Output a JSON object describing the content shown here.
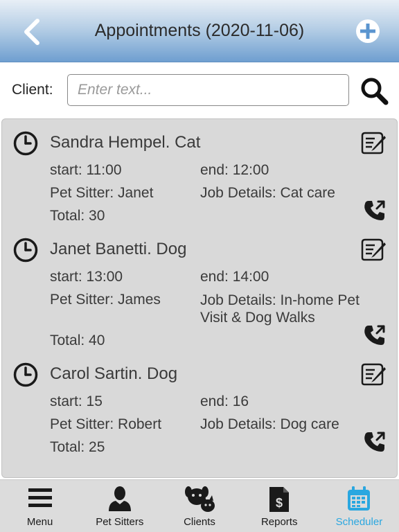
{
  "header": {
    "title": "Appointments (2020-11-06)",
    "back_icon": "chevron-left-icon",
    "add_icon": "plus-circle-icon"
  },
  "filter": {
    "label": "Client:",
    "placeholder": "Enter text...",
    "value": "",
    "search_icon": "search-icon"
  },
  "appointments": [
    {
      "title": "Sandra Hempel. Cat",
      "start": "start: 11:00",
      "end": "end: 12:00",
      "sitter": "Pet Sitter: Janet",
      "details": "Job Details: Cat care",
      "total": "Total: 30"
    },
    {
      "title": "Janet Banetti. Dog",
      "start": "start: 13:00",
      "end": "end: 14:00",
      "sitter": "Pet Sitter: James",
      "details": "Job Details: In-home Pet Visit & Dog Walks",
      "total": "Total: 40"
    },
    {
      "title": "Carol Sartin. Dog",
      "start": "start: 15",
      "end": "end: 16",
      "sitter": "Pet Sitter: Robert",
      "details": "Job Details: Dog care",
      "total": "Total: 25"
    }
  ],
  "nav": {
    "items": [
      {
        "label": "Menu",
        "icon": "hamburger-icon"
      },
      {
        "label": "Pet Sitters",
        "icon": "person-icon"
      },
      {
        "label": "Clients",
        "icon": "pets-icon"
      },
      {
        "label": "Reports",
        "icon": "invoice-icon"
      },
      {
        "label": "Scheduler",
        "icon": "calendar-icon",
        "active": true
      }
    ]
  },
  "colors": {
    "header_top": "#e8eff6",
    "header_bottom": "#6f9fd0",
    "panel": "#d9d9d9",
    "nav_bg": "#dcdcdc",
    "active": "#2aa7e0"
  }
}
